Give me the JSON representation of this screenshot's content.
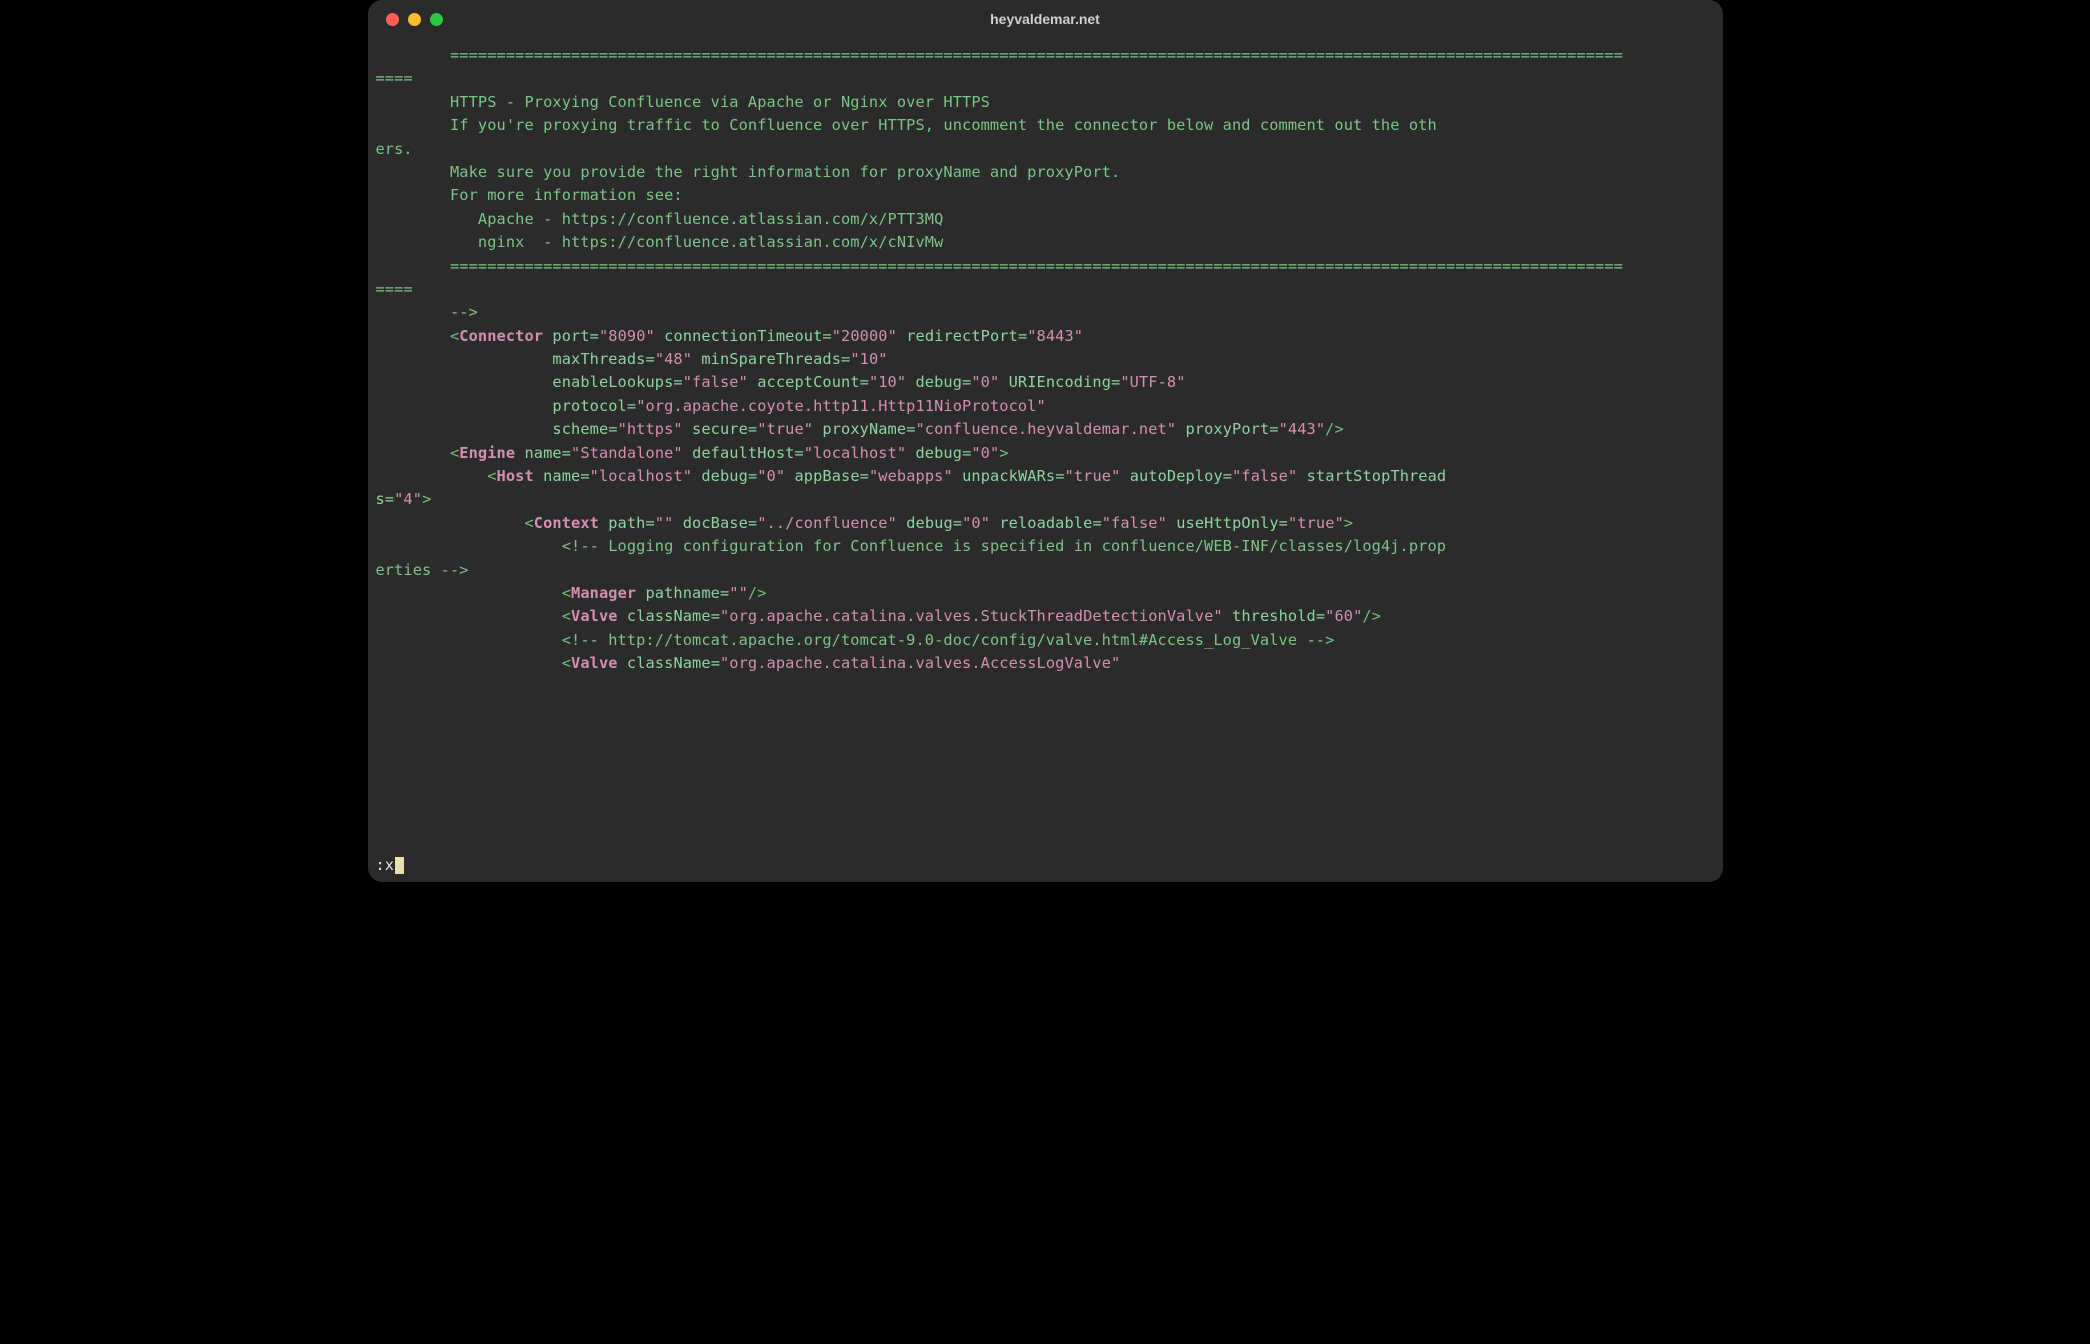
{
  "window": {
    "title": "heyvaldemar.net"
  },
  "cmd": {
    "prefix": ":",
    "text": "x"
  },
  "code": {
    "rule1": "        ==============================================================================================================================",
    "rule1b": "====",
    "h1": "        HTTPS - Proxying Confluence via Apache or Nginx over HTTPS",
    "blank": "",
    "p1a": "        If you're proxying traffic to Confluence over HTTPS, uncomment the connector below and comment out the oth",
    "p1b": "ers.",
    "p2": "        Make sure you provide the right information for proxyName and proxyPort.",
    "p3": "        For more information see:",
    "p4": "           Apache - https://confluence.atlassian.com/x/PTT3MQ",
    "p5": "           nginx  - https://confluence.atlassian.com/x/cNIvMw",
    "rule2": "        ==============================================================================================================================",
    "rule2b": "====",
    "endc": "        -->",
    "conn": {
      "indent": "        ",
      "tag": "Connector",
      "l1": [
        {
          "a": "port",
          "v": "8090"
        },
        {
          "a": "connectionTimeout",
          "v": "20000"
        },
        {
          "a": "redirectPort",
          "v": "8443"
        }
      ],
      "l2": [
        {
          "a": "maxThreads",
          "v": "48"
        },
        {
          "a": "minSpareThreads",
          "v": "10"
        }
      ],
      "l3": [
        {
          "a": "enableLookups",
          "v": "false"
        },
        {
          "a": "acceptCount",
          "v": "10"
        },
        {
          "a": "debug",
          "v": "0"
        },
        {
          "a": "URIEncoding",
          "v": "UTF-8"
        }
      ],
      "l4": [
        {
          "a": "protocol",
          "v": "org.apache.coyote.http11.Http11NioProtocol"
        }
      ],
      "l5": [
        {
          "a": "scheme",
          "v": "https"
        },
        {
          "a": "secure",
          "v": "true"
        },
        {
          "a": "proxyName",
          "v": "confluence.heyvaldemar.net"
        },
        {
          "a": "proxyPort",
          "v": "443"
        }
      ],
      "contIndent": "                   "
    },
    "engine": {
      "indent": "        ",
      "tag": "Engine",
      "attrs": [
        {
          "a": "name",
          "v": "Standalone"
        },
        {
          "a": "defaultHost",
          "v": "localhost"
        },
        {
          "a": "debug",
          "v": "0"
        }
      ]
    },
    "host": {
      "indent": "            ",
      "tag": "Host",
      "attrs1": [
        {
          "a": "name",
          "v": "localhost"
        },
        {
          "a": "debug",
          "v": "0"
        },
        {
          "a": "appBase",
          "v": "webapps"
        },
        {
          "a": "unpackWARs",
          "v": "true"
        },
        {
          "a": "autoDeploy",
          "v": "false"
        }
      ],
      "wrapAttr": {
        "a": "startStopThread"
      },
      "wrapCont": "s=",
      "wrapVal": "4"
    },
    "context": {
      "indent": "                ",
      "tag": "Context",
      "attrs": [
        {
          "a": "path",
          "v": ""
        },
        {
          "a": "docBase",
          "v": "../confluence"
        },
        {
          "a": "debug",
          "v": "0"
        },
        {
          "a": "reloadable",
          "v": "false"
        },
        {
          "a": "useHttpOnly",
          "v": "true"
        }
      ]
    },
    "logcmt": {
      "a": "                    <!-- Logging configuration for Confluence is specified in confluence/WEB-INF/classes/log4j.prop",
      "b": "erties -->"
    },
    "manager": {
      "indent": "                    ",
      "tag": "Manager",
      "attrs": [
        {
          "a": "pathname",
          "v": ""
        }
      ]
    },
    "valve1": {
      "indent": "                    ",
      "tag": "Valve",
      "attrs": [
        {
          "a": "className",
          "v": "org.apache.catalina.valves.StuckThreadDetectionValve"
        },
        {
          "a": "threshold",
          "v": "60"
        }
      ]
    },
    "valvecmt": "                    <!-- http://tomcat.apache.org/tomcat-9.0-doc/config/valve.html#Access_Log_Valve -->",
    "valve2": {
      "indent": "                    ",
      "tag": "Valve",
      "attrs": [
        {
          "a": "className",
          "v": "org.apache.catalina.valves.AccessLogValve"
        }
      ]
    }
  }
}
